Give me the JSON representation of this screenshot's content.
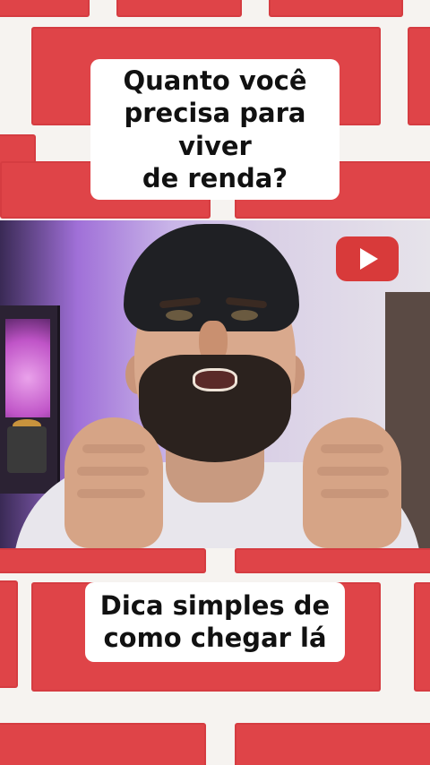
{
  "top_caption": "Quanto você\nprecisa para viver\nde renda?",
  "bottom_caption": "Dica simples de\ncomo chegar lá",
  "icons": {
    "video_logo": "youtube-play-icon"
  },
  "colors": {
    "brick": "#df4448",
    "mortar": "#f6f3f0",
    "caption_bg": "#ffffff",
    "caption_text": "#111111",
    "youtube_red": "#d83a3a"
  }
}
